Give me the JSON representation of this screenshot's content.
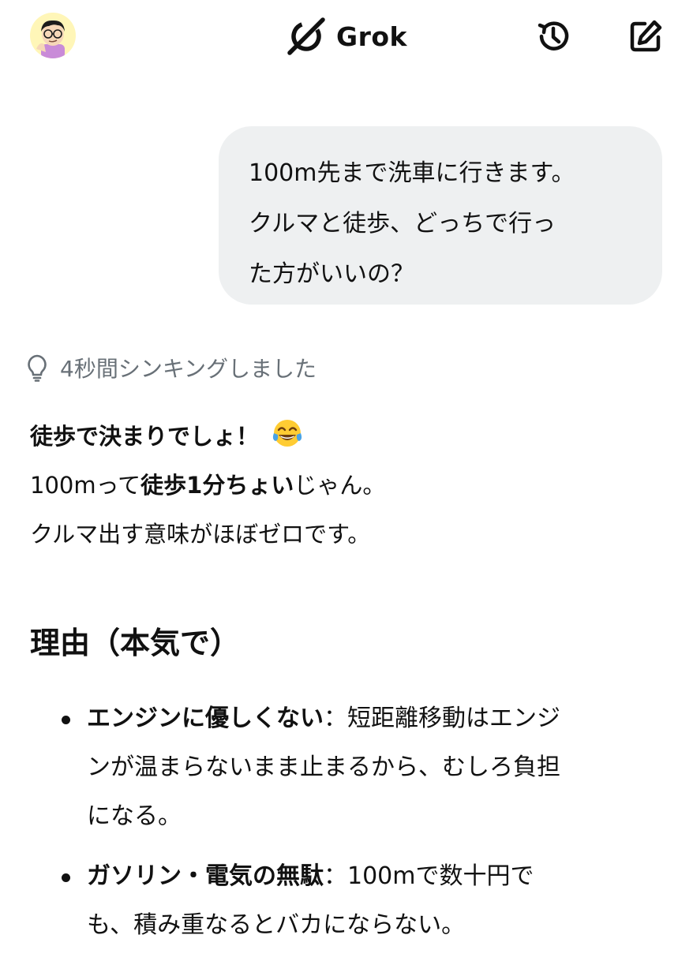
{
  "header": {
    "brand_name": "Grok",
    "avatar_icon": "user-avatar",
    "history_icon": "history-icon",
    "compose_icon": "new-chat-icon"
  },
  "user_message": {
    "lines": [
      "100m先まで洗車に行きます。",
      "クルマと徒歩、どっちで行っ",
      "た方がいいの？"
    ]
  },
  "thinking": {
    "icon": "lightbulb-icon",
    "label": "4秒間シンキングしました"
  },
  "answer": {
    "headline": "徒歩で決まりでしょ！",
    "headline_emoji": "face-with-tears-of-joy",
    "line2_prefix": "100mって",
    "line2_bold": "徒歩1分ちょい",
    "line2_suffix": "じゃん。",
    "line3": "クルマ出す意味がほぼゼロです。"
  },
  "section": {
    "heading": "理由（本気で）",
    "bullets": [
      {
        "title": "エンジンに優しくない",
        "line1_rest": "：短距離移動はエンジ",
        "line2": "ンが温まらないまま止まるから、むしろ負担",
        "line3": "になる。"
      },
      {
        "title": "ガソリン・電気の無駄",
        "line1_rest": "：100mで数十円で",
        "line2": "も、積み重なるとバカにならない。"
      }
    ]
  },
  "colors": {
    "background": "#ffffff",
    "text": "#111111",
    "bubble": "#eef0f1",
    "muted": "#687077"
  }
}
